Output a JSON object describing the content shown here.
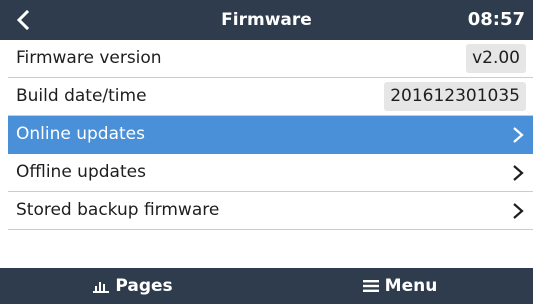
{
  "header": {
    "title": "Firmware",
    "time": "08:57",
    "back_icon": "chevron-left-icon"
  },
  "rows": [
    {
      "label": "Firmware version",
      "value": "v2.00"
    },
    {
      "label": "Build date/time",
      "value": "201612301035"
    },
    {
      "label": "Online updates",
      "selected": true
    },
    {
      "label": "Offline updates"
    },
    {
      "label": "Stored backup firmware"
    }
  ],
  "footer": {
    "pages_label": "Pages",
    "pages_icon": "bar-chart-icon",
    "menu_label": "Menu",
    "menu_icon": "hamburger-icon"
  },
  "colors": {
    "header_bg": "#2e3c4d",
    "selected_bg": "#4a90d9",
    "value_bg": "#e6e6e6"
  }
}
